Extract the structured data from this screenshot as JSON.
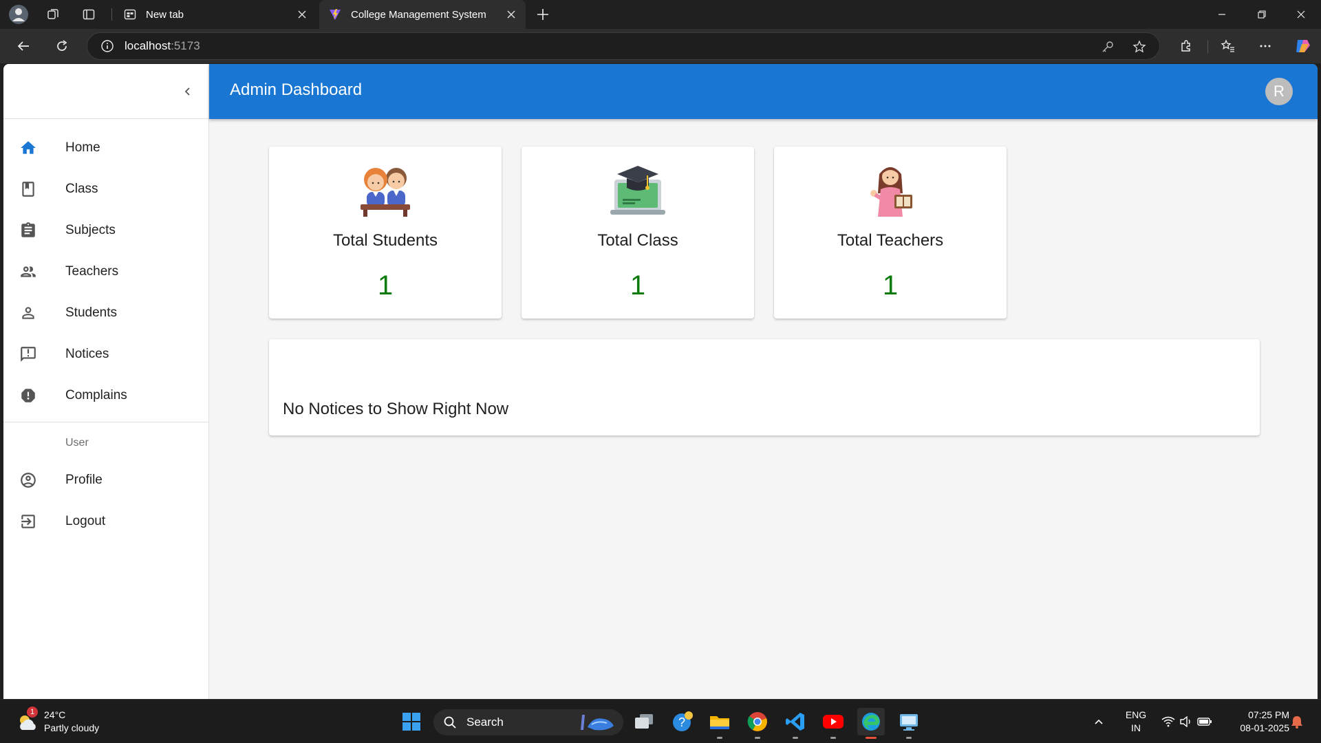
{
  "browser": {
    "tabs": [
      {
        "title": "New tab",
        "active": false
      },
      {
        "title": "College Management System",
        "active": true
      }
    ],
    "url": {
      "host": "localhost",
      "port": ":5173"
    }
  },
  "sidebar": {
    "items": [
      {
        "label": "Home",
        "icon": "home-icon"
      },
      {
        "label": "Class",
        "icon": "class-icon"
      },
      {
        "label": "Subjects",
        "icon": "assignment-icon"
      },
      {
        "label": "Teachers",
        "icon": "supervisor-account-icon"
      },
      {
        "label": "Students",
        "icon": "person-outline-icon"
      },
      {
        "label": "Notices",
        "icon": "announcement-outline-icon"
      },
      {
        "label": "Complains",
        "icon": "report-icon"
      }
    ],
    "user_header": "User",
    "user_items": [
      {
        "label": "Profile",
        "icon": "account-circle-outline-icon"
      },
      {
        "label": "Logout",
        "icon": "exit-to-app-icon"
      }
    ]
  },
  "appbar": {
    "title": "Admin Dashboard",
    "avatar_initial": "R",
    "color": "#1976d2"
  },
  "stats": [
    {
      "title": "Total Students",
      "value": "1",
      "icon": "students-illustration"
    },
    {
      "title": "Total Class",
      "value": "1",
      "icon": "graduation-laptop-illustration"
    },
    {
      "title": "Total Teachers",
      "value": "1",
      "icon": "teacher-illustration"
    }
  ],
  "stat_value_color": "#0a7a0a",
  "notices": {
    "empty_message": "No Notices to Show Right Now"
  },
  "taskbar": {
    "weather": {
      "temp": "24°C",
      "desc": "Partly cloudy",
      "badge": "1"
    },
    "search_label": "Search",
    "language": {
      "line1": "ENG",
      "line2": "IN"
    },
    "clock": {
      "time": "07:25 PM",
      "date": "08-01-2025"
    }
  }
}
